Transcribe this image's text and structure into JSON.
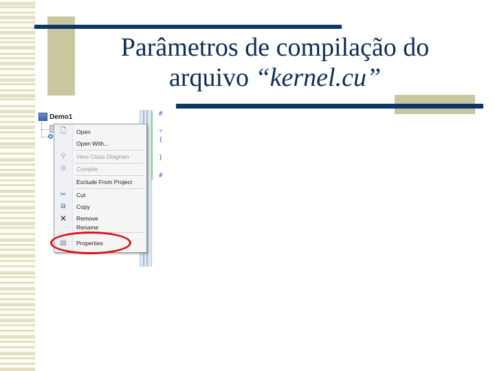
{
  "slide": {
    "title_line1": "Parâmetros de compilação do",
    "title_line2_prefix": "arquivo ",
    "title_line2_quoted": "“kernel.cu”",
    "colors": {
      "title_text": "#0d2d55",
      "accent_bar": "#0d3566",
      "accent_block": "#c9c79d",
      "stripe": "#e2dfc6",
      "highlight_ring": "#d8121a"
    }
  },
  "solution_explorer": {
    "project_name": "Demo1",
    "project_icon": "project-icon"
  },
  "editor": {
    "glyphs": [
      "#",
      "▿",
      "{",
      "}",
      "#"
    ]
  },
  "context_menu": {
    "items": [
      {
        "label": "Open",
        "icon": "open-file-icon",
        "enabled": true
      },
      {
        "label": "Open With...",
        "icon": "",
        "enabled": true
      },
      {
        "label": "View Class Diagram",
        "icon": "class-diagram-icon",
        "enabled": false
      },
      {
        "label": "Compile",
        "icon": "compile-icon",
        "enabled": false
      },
      {
        "label": "Exclude From Project",
        "icon": "",
        "enabled": true
      },
      {
        "label": "Cut",
        "icon": "scissors-icon",
        "enabled": true
      },
      {
        "label": "Copy",
        "icon": "copy-icon",
        "enabled": true
      },
      {
        "label": "Remove",
        "icon": "remove-x-icon",
        "enabled": true
      },
      {
        "label": "Rename",
        "icon": "",
        "enabled": true
      },
      {
        "label": "Properties",
        "icon": "properties-icon",
        "enabled": true,
        "highlighted": true
      }
    ]
  }
}
